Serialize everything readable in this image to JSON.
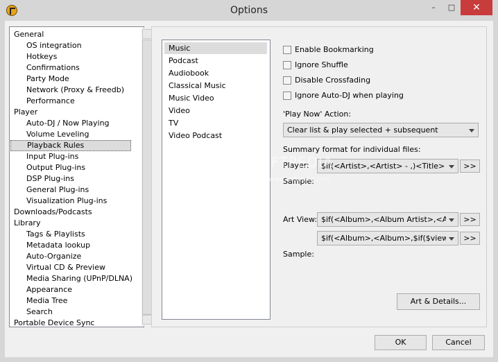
{
  "window": {
    "title": "Options",
    "minimize": "–",
    "maximize": "□",
    "close": "✕"
  },
  "tree": {
    "items": [
      {
        "label": "General",
        "level": 0
      },
      {
        "label": "OS integration",
        "level": 1
      },
      {
        "label": "Hotkeys",
        "level": 1
      },
      {
        "label": "Confirmations",
        "level": 1
      },
      {
        "label": "Party Mode",
        "level": 1
      },
      {
        "label": "Network (Proxy & Freedb)",
        "level": 1
      },
      {
        "label": "Performance",
        "level": 1
      },
      {
        "label": "Player",
        "level": 0
      },
      {
        "label": "Auto-DJ / Now Playing",
        "level": 1
      },
      {
        "label": "Volume Leveling",
        "level": 1
      },
      {
        "label": "Playback Rules",
        "level": 1,
        "selected": true
      },
      {
        "label": "Input Plug-ins",
        "level": 1
      },
      {
        "label": "Output Plug-ins",
        "level": 1
      },
      {
        "label": "DSP Plug-ins",
        "level": 1
      },
      {
        "label": "General Plug-ins",
        "level": 1
      },
      {
        "label": "Visualization Plug-ins",
        "level": 1
      },
      {
        "label": "Downloads/Podcasts",
        "level": 0
      },
      {
        "label": "Library",
        "level": 0
      },
      {
        "label": "Tags & Playlists",
        "level": 1
      },
      {
        "label": "Metadata lookup",
        "level": 1
      },
      {
        "label": "Auto-Organize",
        "level": 1
      },
      {
        "label": "Virtual CD & Preview",
        "level": 1
      },
      {
        "label": "Media Sharing (UPnP/DLNA)",
        "level": 1
      },
      {
        "label": "Appearance",
        "level": 1
      },
      {
        "label": "Media Tree",
        "level": 1
      },
      {
        "label": "Search",
        "level": 1
      },
      {
        "label": "Portable Device Sync",
        "level": 0
      }
    ]
  },
  "categories": {
    "items": [
      "Music",
      "Podcast",
      "Audiobook",
      "Classical Music",
      "Music Video",
      "Video",
      "TV",
      "Video Podcast"
    ],
    "selected": "Music"
  },
  "options": {
    "enable_bookmarking": "Enable Bookmarking",
    "ignore_shuffle": "Ignore Shuffle",
    "disable_crossfading": "Disable Crossfading",
    "ignore_autodj": "Ignore Auto-DJ when playing",
    "play_now_label": "'Play Now' Action:",
    "play_now_value": "Clear list & play selected + subsequent",
    "summary_label": "Summary format for individual files:",
    "player_label": "Player:",
    "player_value": "$if(<Artist>,<Artist> - ,)<Title>",
    "sample1_label": "Sample:",
    "artview_label": "Art View:",
    "artview_value1": "$if(<Album>,<Album Artist>,<Artist",
    "artview_value2": "$if(<Album>,<Album>,$if($viewmod",
    "sample2_label": "Sample:",
    "expand_label": ">>",
    "art_details_label": "Art & Details...",
    "watermark": "SOFTPEDIA",
    "watermark_sub": "www.softpedia.com"
  },
  "dialog": {
    "ok": "OK",
    "cancel": "Cancel"
  }
}
